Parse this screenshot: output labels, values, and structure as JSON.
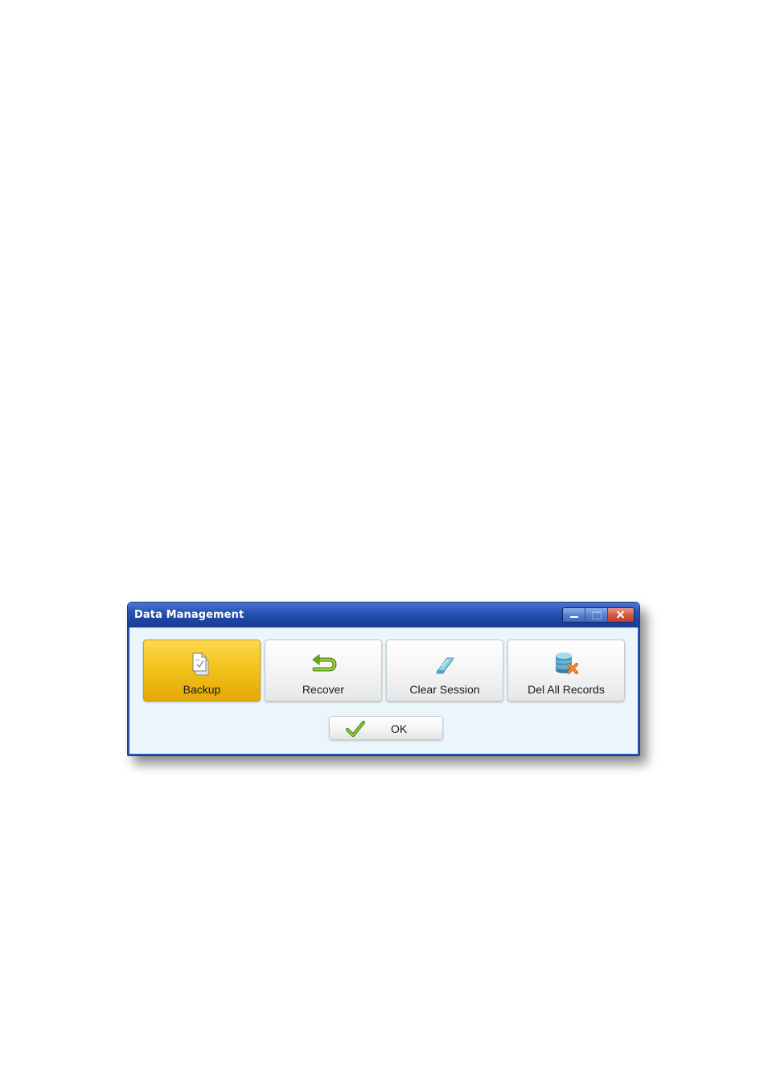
{
  "window": {
    "title": "Data Management",
    "controls": [
      "minimize",
      "maximize",
      "close"
    ]
  },
  "actions": [
    {
      "id": "backup",
      "label": "Backup",
      "icon": "backup-document-icon",
      "active": true
    },
    {
      "id": "recover",
      "label": "Recover",
      "icon": "return-arrow-icon",
      "active": false
    },
    {
      "id": "clear-session",
      "label": "Clear Session",
      "icon": "eraser-icon",
      "active": false
    },
    {
      "id": "del-all-records",
      "label": "Del All Records",
      "icon": "database-delete-icon",
      "active": false
    }
  ],
  "ok_button": {
    "label": "OK",
    "icon": "checkmark-icon"
  },
  "colors": {
    "title_bar": "#1e44a0",
    "active_tile": "#f3c31c",
    "dialog_background": "#eaf6fb",
    "close_button": "#d45a44"
  }
}
